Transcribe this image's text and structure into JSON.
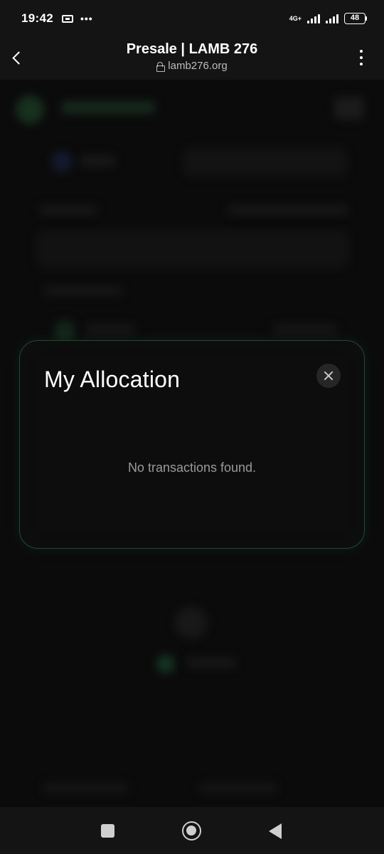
{
  "status_bar": {
    "time": "19:42",
    "network": "4G+",
    "battery": "48"
  },
  "browser": {
    "title": "Presale | LAMB 276",
    "url": "lamb276.org"
  },
  "modal": {
    "title": "My Allocation",
    "empty_message": "No transactions found."
  },
  "colors": {
    "background": "#0b0b0b",
    "bar": "#141414",
    "modal_border": "#1f4a36",
    "muted_text": "#9a9a9a"
  },
  "icons": [
    "sim-card-icon",
    "more-dots-icon",
    "lock-icon",
    "back-arrow-icon",
    "kebab-menu-icon",
    "close-icon",
    "recents-icon",
    "home-icon",
    "back-triangle-icon"
  ]
}
